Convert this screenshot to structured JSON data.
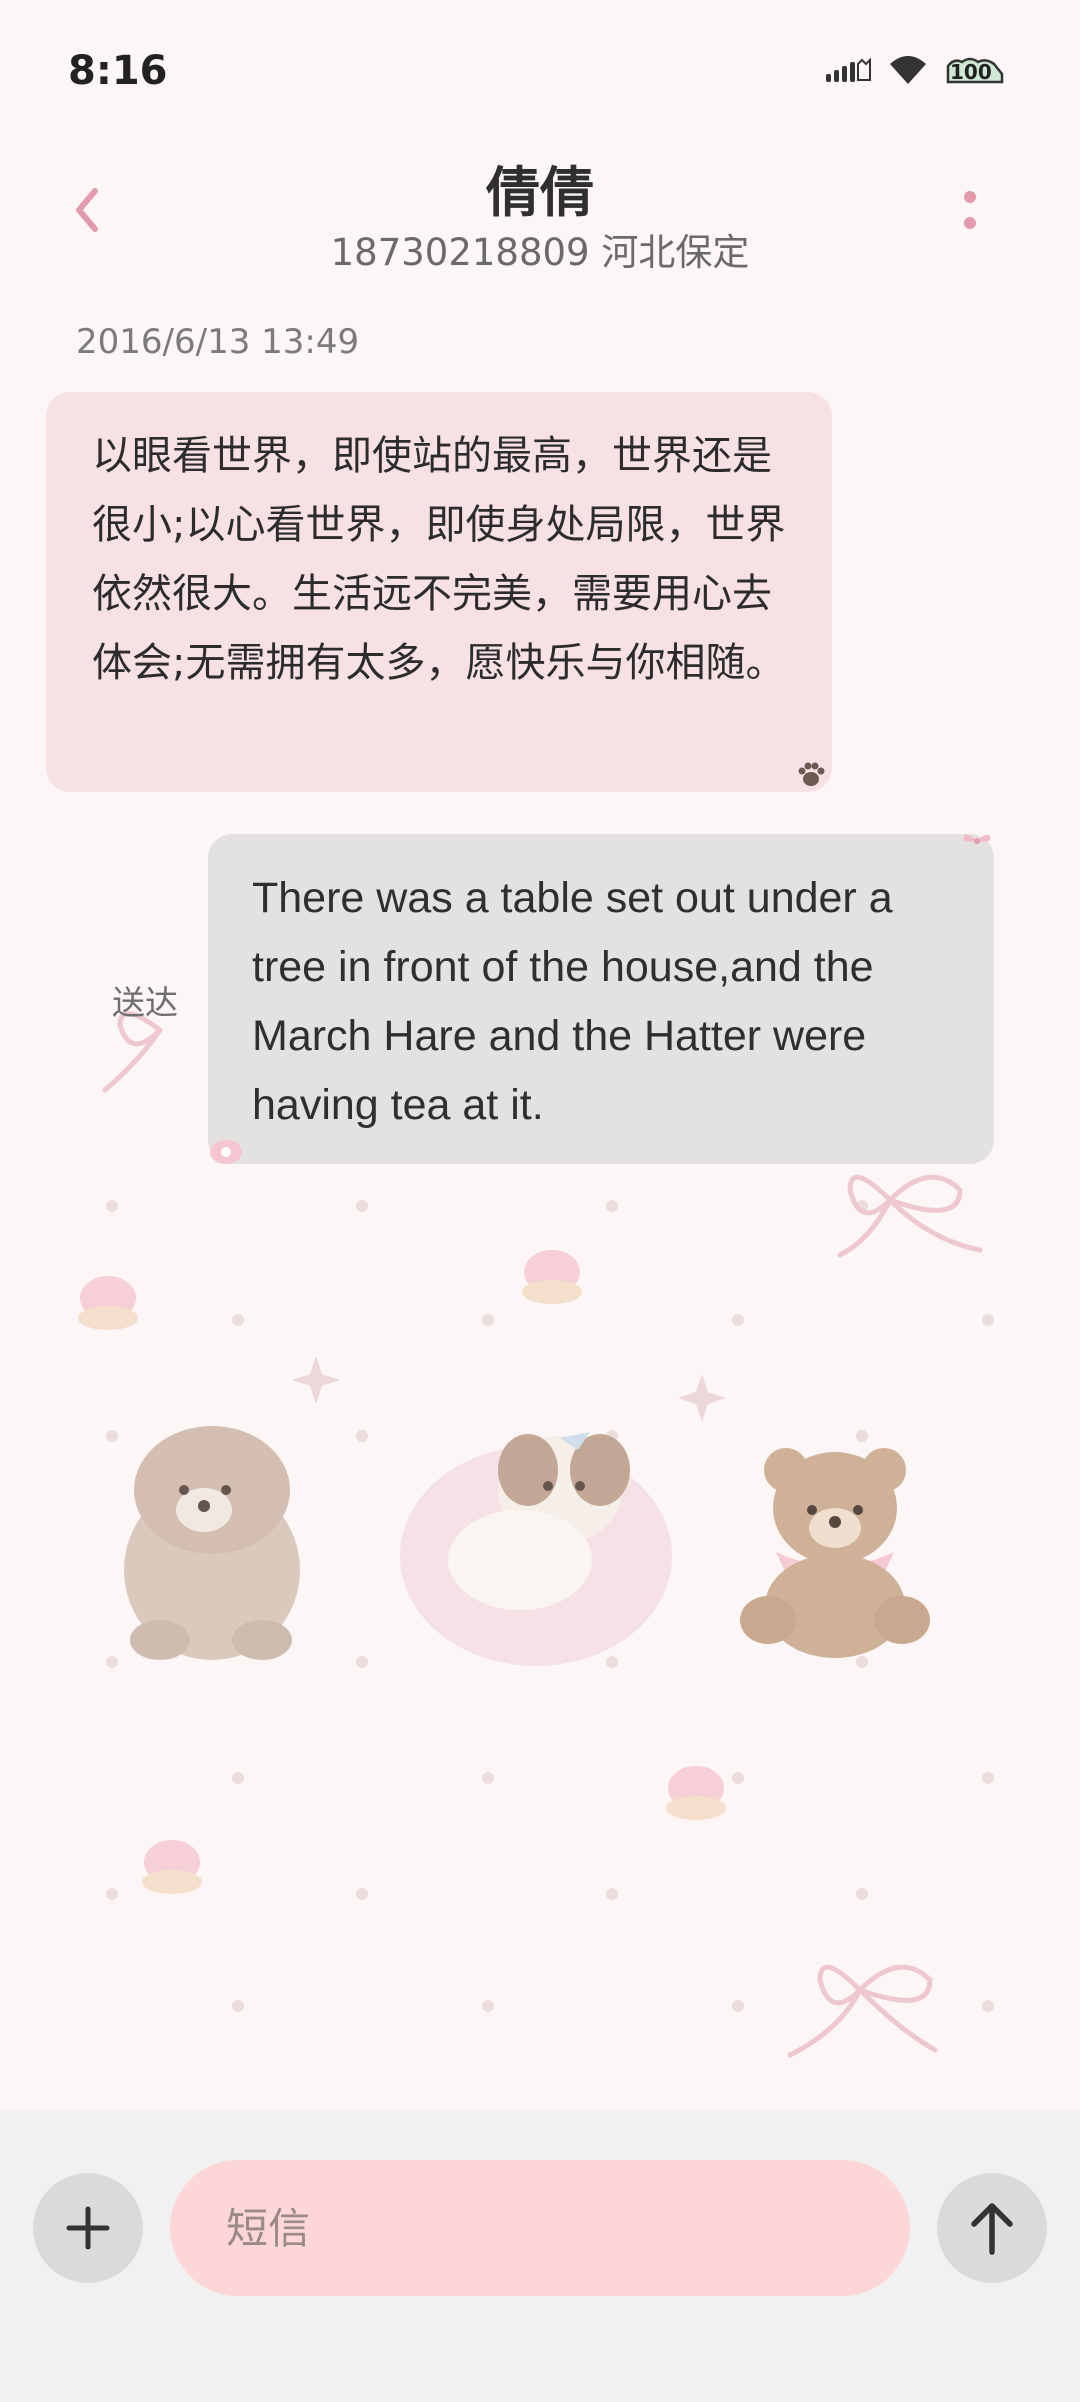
{
  "status_bar": {
    "time": "8:16",
    "battery": "100"
  },
  "header": {
    "contact_name": "倩倩",
    "contact_subtitle": "18730218809 河北保定"
  },
  "conversation": {
    "timestamp": "2016/6/13 13:49",
    "incoming_message": "以眼看世界，即使站的最高，世界还是很小;以心看世界，即使身处局限，世界依然很大。生活远不完美，需要用心去体会;无需拥有太多，愿快乐与你相随。",
    "outgoing_message": "There was a table set out under a tree in front of the house,and the March Hare and the Hatter were having tea at it.",
    "outgoing_status": "送达"
  },
  "composer": {
    "placeholder": "短信"
  },
  "colors": {
    "background": "#fcf6f6",
    "incoming_bubble": "#f8e1e4",
    "outgoing_bubble": "#e4e1e1",
    "accent": "#e39aaa",
    "input_background": "#fdd7d7"
  }
}
